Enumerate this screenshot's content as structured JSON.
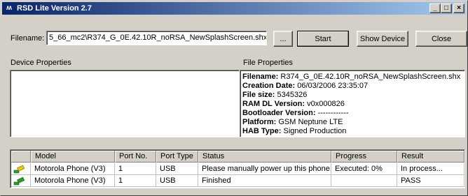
{
  "window": {
    "title": "RSD Lite Version 2.7",
    "app_icon": "motorola-logo-icon",
    "controls": [
      "minimize-icon",
      "maximize-icon",
      "close-icon"
    ]
  },
  "toolbar": {
    "filename_label": "Filename:",
    "filename_value": "5_66_mc2\\R374_G_0E.42.10R_noRSA_NewSplashScreen.shx",
    "browse_label": "...",
    "start_label": "Start",
    "show_device_label": "Show Device",
    "close_label": "Close"
  },
  "device_properties": {
    "heading": "Device Properties"
  },
  "file_properties": {
    "heading": "File Properties",
    "rows": [
      {
        "key": "Filename:",
        "value": " R374_G_0E.42.10R_noRSA_NewSplashScreen.shx"
      },
      {
        "key": "Creation Date:",
        "value": " 06/03/2006 23:35:07"
      },
      {
        "key": "File size:",
        "value": " 5345326"
      },
      {
        "key": "RAM DL Version:",
        "value": " v0x000826"
      },
      {
        "key": "Bootloader Version:",
        "value": " ------------"
      },
      {
        "key": "Platform:",
        "value": " GSM Neptune LTE"
      },
      {
        "key": "HAB Type:",
        "value": " Signed Production"
      }
    ]
  },
  "device_list": {
    "columns": [
      "",
      "Model",
      "Port No.",
      "Port Type",
      "Status",
      "Progress",
      "Result"
    ],
    "rows": [
      {
        "icon": "usb-phone-connected-icon",
        "model": "Motorola Phone (V3)",
        "port_no": "1",
        "port_type": "USB",
        "status": "Please manually power up this phone.",
        "progress": "Executed: 0%",
        "result": "In process..."
      },
      {
        "icon": "usb-phone-connected-icon",
        "model": "Motorola Phone (V3)",
        "port_no": "1",
        "port_type": "USB",
        "status": "Finished",
        "progress": "",
        "result": "PASS"
      }
    ]
  },
  "colors": {
    "titlebar_start": "#0a246a",
    "titlebar_end": "#a6caf0",
    "face": "#d4d0c8",
    "phone_green": "#2e9a2e",
    "phone_yellow": "#e8c800"
  }
}
